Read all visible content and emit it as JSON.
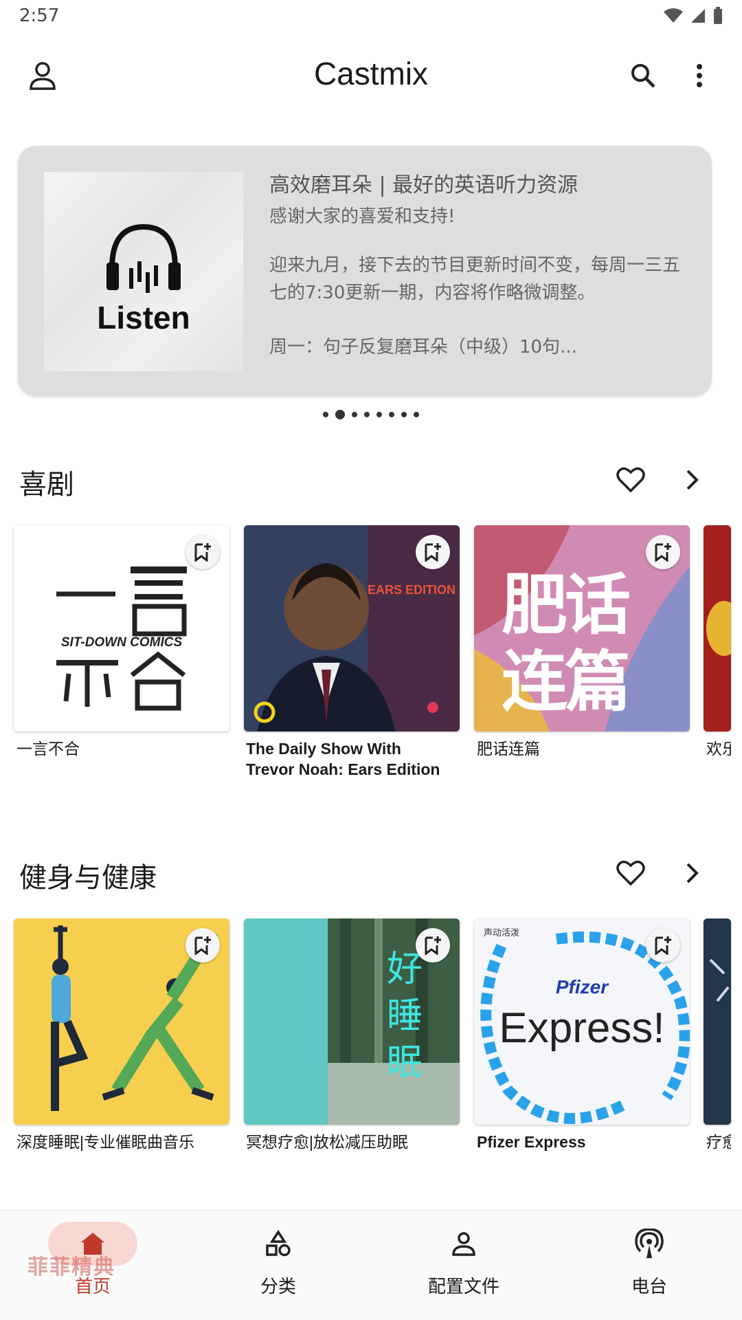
{
  "status_bar": {
    "time": "2:57"
  },
  "app_bar": {
    "title": "Castmix"
  },
  "banner": {
    "art_word": "Listen",
    "title": "高效磨耳朵 | 最好的英语听力资源",
    "line1": "感谢大家的喜爱和支持!",
    "line2": "迎来九月，接下去的节目更新时间不变，每周一三五七的7:30更新一期，内容将作略微调整。",
    "line3": "周一：句子反复磨耳朵（中级）10句...",
    "pager_count": 8,
    "pager_active_index": 1
  },
  "sections": [
    {
      "title": "喜剧",
      "items": [
        {
          "title": "一言不合",
          "art_text": "SIT-DOWN COMICS"
        },
        {
          "title": "The Daily Show With Trevor Noah: Ears Edition",
          "art_text": "EARS EDITION"
        },
        {
          "title": "肥话连篇",
          "art_text": "肥话连篇"
        },
        {
          "title": "欢乐"
        }
      ]
    },
    {
      "title": "健身与健康",
      "items": [
        {
          "title": "深度睡眠|专业催眠曲音乐"
        },
        {
          "title": "冥想疗愈|放松减压助眠",
          "art_text": "好睡眠"
        },
        {
          "title": "Pfizer Express",
          "art_text": "Express!",
          "art_brand": "Pfizer",
          "art_top": "声动活泼"
        },
        {
          "title": "疗愈"
        }
      ]
    }
  ],
  "bottom_nav": [
    {
      "label": "首页",
      "icon": "home-icon",
      "selected": true
    },
    {
      "label": "分类",
      "icon": "category-icon",
      "selected": false
    },
    {
      "label": "配置文件",
      "icon": "profile-icon",
      "selected": false
    },
    {
      "label": "电台",
      "icon": "podcast-icon",
      "selected": false
    }
  ],
  "watermark": "菲菲精典"
}
